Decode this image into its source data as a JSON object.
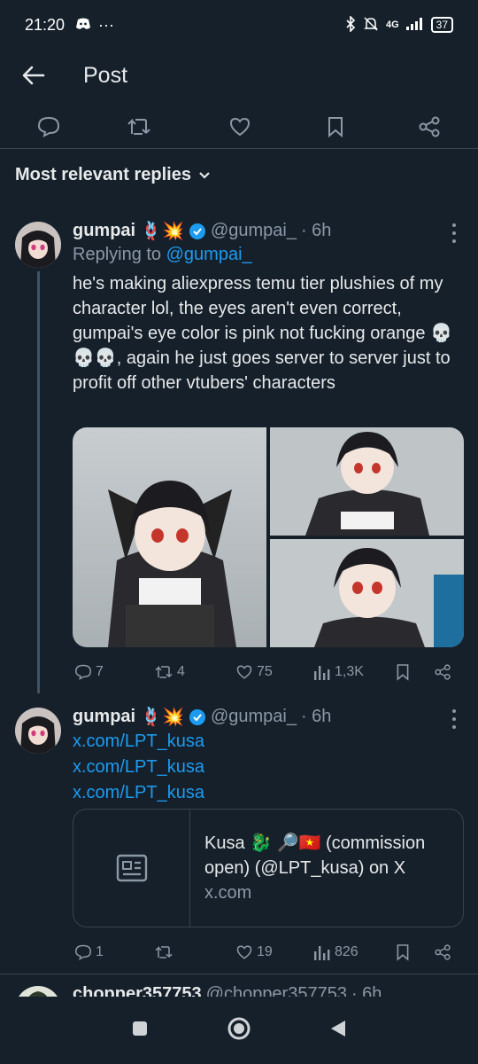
{
  "status": {
    "time": "21:20",
    "network": "4G",
    "battery": "37",
    "dots": "···"
  },
  "topbar": {
    "title": "Post"
  },
  "sort": {
    "label": "Most relevant replies"
  },
  "replies": [
    {
      "name": "gumpai",
      "handle": "@gumpai_",
      "time": "· 6h",
      "replying_prefix": "Replying to",
      "replying_to": "@gumpai_",
      "text": "he's making aliexpress temu tier plushies of my character lol, the eyes aren't even correct, gumpai's eye color is pink not fucking orange 💀💀💀, again he just goes server to server just to profit off other vtubers' characters",
      "stats": {
        "replies": "7",
        "reposts": "4",
        "likes": "75",
        "views": "1,3K"
      }
    },
    {
      "name": "gumpai",
      "handle": "@gumpai_",
      "time": "· 6h",
      "links": [
        "x.com/LPT_kusa",
        "x.com/LPT_kusa",
        "x.com/LPT_kusa"
      ],
      "card": {
        "title": "Kusa 🐉 🔎🇻🇳 (commission open) (@LPT_kusa) on X",
        "domain": "x.com"
      },
      "stats": {
        "replies": "1",
        "reposts": "",
        "likes": "19",
        "views": "826"
      }
    },
    {
      "name": "chopper357753",
      "handle": "@chopper357753",
      "time": "· 6h"
    }
  ],
  "colors": {
    "background": "#15202b",
    "accent": "#1d9bf0",
    "muted": "#8b98a5",
    "verified": "#1d9bf0"
  }
}
